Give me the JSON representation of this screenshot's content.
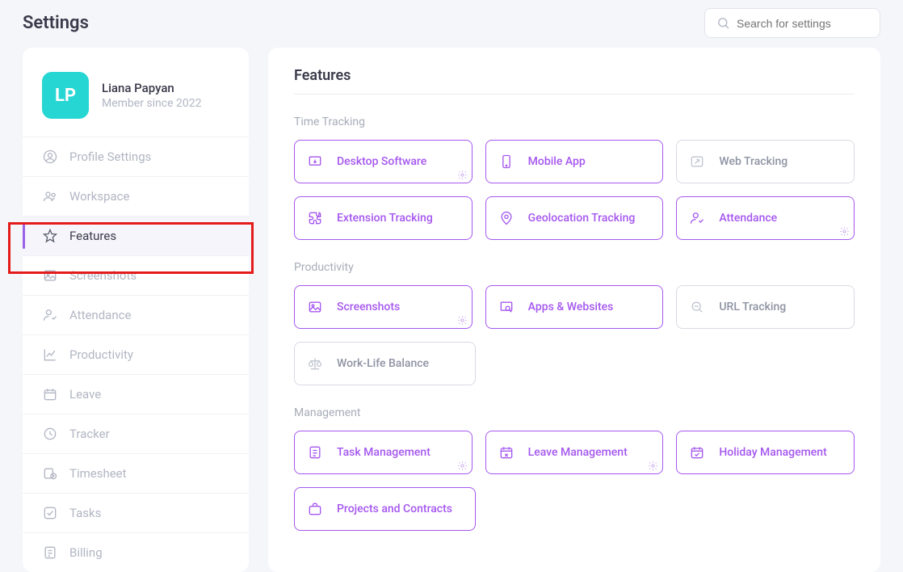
{
  "page_title": "Settings",
  "search": {
    "placeholder": "Search for settings"
  },
  "profile": {
    "initials": "LP",
    "name": "Liana Papyan",
    "since": "Member since 2022"
  },
  "sidebar": {
    "items": [
      {
        "label": "Profile Settings"
      },
      {
        "label": "Workspace"
      },
      {
        "label": "Features"
      },
      {
        "label": "Screenshots"
      },
      {
        "label": "Attendance"
      },
      {
        "label": "Productivity"
      },
      {
        "label": "Leave"
      },
      {
        "label": "Tracker"
      },
      {
        "label": "Timesheet"
      },
      {
        "label": "Tasks"
      },
      {
        "label": "Billing"
      }
    ],
    "active_index": 2
  },
  "main": {
    "title": "Features",
    "sections": [
      {
        "label": "Time Tracking",
        "cards": [
          {
            "label": "Desktop Software",
            "has_gear": true
          },
          {
            "label": "Mobile App"
          },
          {
            "label": "Web Tracking",
            "disabled": true
          }
        ]
      },
      {
        "cards": [
          {
            "label": "Extension Tracking"
          },
          {
            "label": "Geolocation Tracking"
          },
          {
            "label": "Attendance",
            "has_gear": true
          }
        ]
      },
      {
        "label": "Productivity",
        "cards": [
          {
            "label": "Screenshots",
            "has_gear": true
          },
          {
            "label": "Apps & Websites"
          },
          {
            "label": "URL Tracking",
            "disabled": true
          }
        ]
      },
      {
        "cards": [
          {
            "label": "Work-Life Balance",
            "disabled": true
          }
        ]
      },
      {
        "label": "Management",
        "cards": [
          {
            "label": "Task Management",
            "has_gear": true
          },
          {
            "label": "Leave Management",
            "has_gear": true
          },
          {
            "label": "Holiday Management"
          }
        ]
      },
      {
        "cards": [
          {
            "label": "Projects and Contracts"
          }
        ]
      }
    ]
  }
}
